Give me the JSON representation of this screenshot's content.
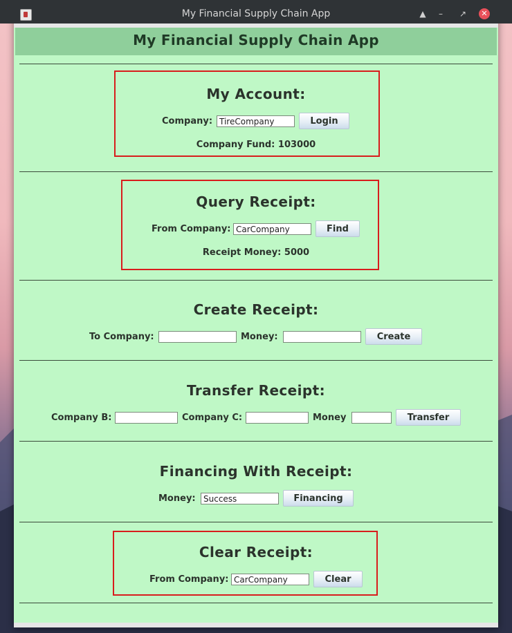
{
  "window": {
    "title": "My Financial Supply Chain App"
  },
  "header": {
    "title": "My Financial Supply Chain App"
  },
  "account": {
    "title": "My Account:",
    "company_label": "Company:",
    "company_value": "TireCompany",
    "login_label": "Login",
    "fund_label": "Company Fund:",
    "fund_value": "103000"
  },
  "query": {
    "title": "Query Receipt:",
    "from_label": "From Company:",
    "from_value": "CarCompany",
    "find_label": "Find",
    "money_label": "Receipt Money:",
    "money_value": "5000"
  },
  "create": {
    "title": "Create Receipt:",
    "to_label": "To Company:",
    "to_value": "",
    "money_label": "Money:",
    "money_value": "",
    "create_label": "Create"
  },
  "transfer": {
    "title": "Transfer Receipt:",
    "b_label": "Company B:",
    "b_value": "",
    "c_label": "Company C:",
    "c_value": "",
    "money_label": "Money",
    "money_value": "",
    "transfer_label": "Transfer"
  },
  "financing": {
    "title": "Financing With Receipt:",
    "money_label": "Money:",
    "money_value": "Success",
    "financing_label": "Financing"
  },
  "clear": {
    "title": "Clear Receipt:",
    "from_label": "From Company:",
    "from_value": "CarCompany",
    "clear_label": "Clear"
  },
  "colors": {
    "panel_bg": "#bff8c6",
    "header_bg": "#8fcf9b",
    "highlight_border": "#d81c1c",
    "titlebar_bg": "#2f3336",
    "close_button": "#e9505a"
  }
}
